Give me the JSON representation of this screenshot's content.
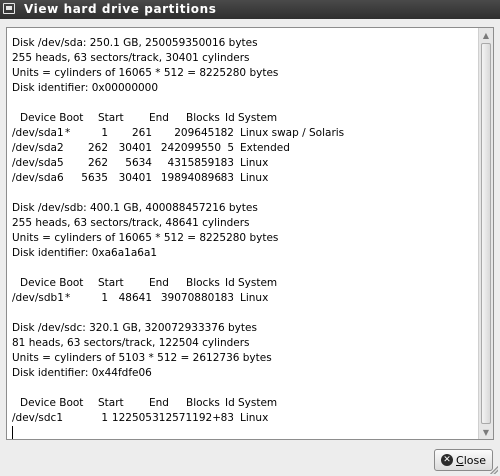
{
  "window": {
    "title": "View hard drive partitions"
  },
  "content": {
    "blocks": [
      {
        "type": "info",
        "lines": [
          "Disk /dev/sda: 250.1 GB, 250059350016 bytes",
          "255 heads, 63 sectors/track, 30401 cylinders",
          "Units = cylinders of 16065 * 512 = 8225280 bytes",
          "Disk identifier: 0x00000000"
        ]
      },
      {
        "type": "table",
        "header": [
          "Device Boot",
          "Start",
          "End",
          "Blocks",
          "Id",
          "System"
        ],
        "rows": [
          [
            "/dev/sda1",
            "*",
            "1",
            "261",
            "2096451",
            "82",
            "Linux swap / Solaris"
          ],
          [
            "/dev/sda2",
            "",
            "262",
            "30401",
            "242099550",
            "5",
            "Extended"
          ],
          [
            "/dev/sda5",
            "",
            "262",
            "5634",
            "43158591",
            "83",
            "Linux"
          ],
          [
            "/dev/sda6",
            "",
            "5635",
            "30401",
            "198940896",
            "83",
            "Linux"
          ]
        ]
      },
      {
        "type": "info",
        "lines": [
          "Disk /dev/sdb: 400.1 GB, 400088457216 bytes",
          "255 heads, 63 sectors/track, 48641 cylinders",
          "Units = cylinders of 16065 * 512 = 8225280 bytes",
          "Disk identifier: 0xa6a1a6a1"
        ]
      },
      {
        "type": "table",
        "header": [
          "Device Boot",
          "Start",
          "End",
          "Blocks",
          "Id",
          "System"
        ],
        "rows": [
          [
            "/dev/sdb1",
            "*",
            "1",
            "48641",
            "390708801",
            "83",
            "Linux"
          ]
        ]
      },
      {
        "type": "info",
        "lines": [
          "Disk /dev/sdc: 320.1 GB, 320072933376 bytes",
          "81 heads, 63 sectors/track, 122504 cylinders",
          "Units = cylinders of 5103 * 512 = 2612736 bytes",
          "Disk identifier: 0x44fdfe06"
        ]
      },
      {
        "type": "table",
        "header": [
          "Device Boot",
          "Start",
          "End",
          "Blocks",
          "Id",
          "System"
        ],
        "rows": [
          [
            "/dev/sdc1",
            "",
            "1",
            "122505",
            "312571192+",
            "83",
            "Linux"
          ]
        ]
      }
    ]
  },
  "buttons": {
    "close": {
      "mnemonic": "C",
      "rest": "lose"
    }
  },
  "icons": {
    "window": "window-icon",
    "close": "close-icon",
    "scroll_up": "chevron-up-icon",
    "scroll_down": "chevron-down-icon"
  }
}
